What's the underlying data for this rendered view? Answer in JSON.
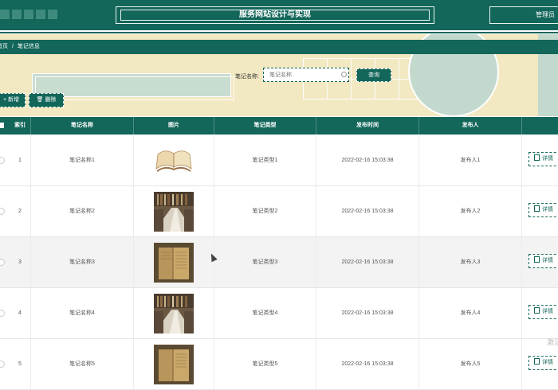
{
  "header": {
    "title": "服务网站设计与实现",
    "admin_label": "管理员"
  },
  "breadcrumb": {
    "home": "首页",
    "separator": "/",
    "current": "笔记信息"
  },
  "search": {
    "label": "笔记名称:",
    "placeholder": "笔记名称",
    "button": "查询"
  },
  "toolbar": {
    "add_label": "+ 新增",
    "delete_label": "🗑 删除"
  },
  "table": {
    "columns": [
      "索引",
      "笔记名称",
      "图片",
      "笔记类型",
      "发布时间",
      "发布人"
    ],
    "rows": [
      {
        "index": "1",
        "name": "笔记名称1",
        "image": "open-book",
        "type": "笔记类型1",
        "time": "2022-02-16 15:03:38",
        "publisher": "发布人1"
      },
      {
        "index": "2",
        "name": "笔记名称2",
        "image": "library-shelves",
        "type": "笔记类型2",
        "time": "2022-02-16 15:03:38",
        "publisher": "发布人2"
      },
      {
        "index": "3",
        "name": "笔记名称3",
        "image": "old-book",
        "type": "笔记类型3",
        "time": "2022-02-16 15:03:38",
        "publisher": "发布人3"
      },
      {
        "index": "4",
        "name": "笔记名称4",
        "image": "library-shelves",
        "type": "笔记类型4",
        "time": "2022-02-16 15:03:38",
        "publisher": "发布人4"
      },
      {
        "index": "5",
        "name": "笔记名称5",
        "image": "old-book",
        "type": "笔记类型5",
        "time": "2022-02-16 15:03:38",
        "publisher": "发布人5"
      }
    ],
    "detail_label": "详情"
  },
  "watermark": "激活"
}
